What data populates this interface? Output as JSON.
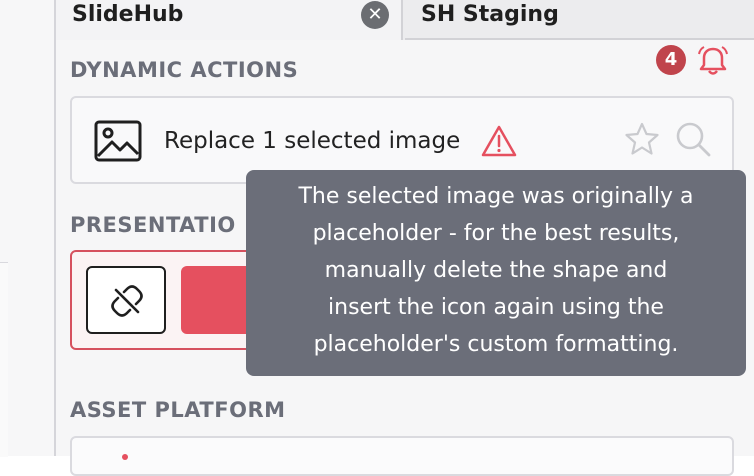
{
  "tabs": [
    {
      "label": "SlideHub",
      "close_glyph": "✕",
      "active": true
    },
    {
      "label": "SH Staging",
      "active": false
    }
  ],
  "notifications": {
    "count": "4",
    "icon": "bell-icon",
    "color": "#e5505f"
  },
  "sections": {
    "dynamic_actions": "DYNAMIC ACTIONS",
    "presentation": "PRESENTATIO",
    "asset_platform": "ASSET PLATFORM"
  },
  "action": {
    "text": "Replace 1 selected image",
    "icons": [
      "image-icon",
      "warning-icon",
      "star-icon",
      "search-icon"
    ]
  },
  "tooltip": {
    "lines": [
      "The selected image was originally a",
      "placeholder - for the best results,",
      "manually delete the shape and",
      "insert the icon again using the",
      "placeholder's custom formatting."
    ]
  },
  "colors": {
    "accent": "#e5505f",
    "tooltip_bg": "#6b6e79",
    "section_title": "#6b6e79"
  }
}
